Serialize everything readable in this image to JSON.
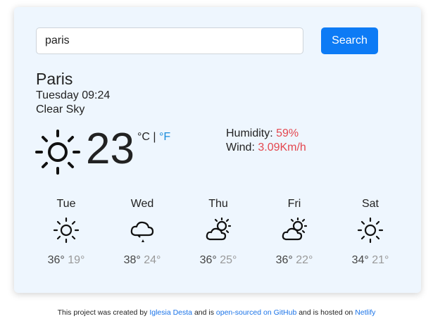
{
  "search": {
    "value": "paris",
    "button_label": "Search"
  },
  "current": {
    "city": "Paris",
    "datetime": "Tuesday 09:24",
    "description": "Clear Sky",
    "icon": "sun-icon",
    "temperature": "23",
    "unit_c": "°C",
    "unit_sep": " | ",
    "unit_f": "°F",
    "humidity_label": "Humidity: ",
    "humidity_value": "59%",
    "wind_label": "Wind: ",
    "wind_value": "3.09Km/h"
  },
  "forecast": [
    {
      "day": "Tue",
      "icon": "sun-icon",
      "max": "36°",
      "min": "19°"
    },
    {
      "day": "Wed",
      "icon": "rain-cloud-icon",
      "max": "38°",
      "min": "24°"
    },
    {
      "day": "Thu",
      "icon": "partly-cloudy-icon",
      "max": "36°",
      "min": "25°"
    },
    {
      "day": "Fri",
      "icon": "partly-cloudy-icon",
      "max": "36°",
      "min": "22°"
    },
    {
      "day": "Sat",
      "icon": "sun-icon",
      "max": "34°",
      "min": "21°"
    }
  ],
  "footer": {
    "t1": "This project was created by ",
    "author_link": "Iglesia Desta",
    "t2": " and is ",
    "github_link": "open-sourced on GitHub",
    "t3": " and is hosted on ",
    "netlify_link": "Netlify"
  },
  "colors": {
    "accent": "#0d7bf5",
    "value_red": "#e4474f",
    "card_bg": "#eef6fe"
  }
}
